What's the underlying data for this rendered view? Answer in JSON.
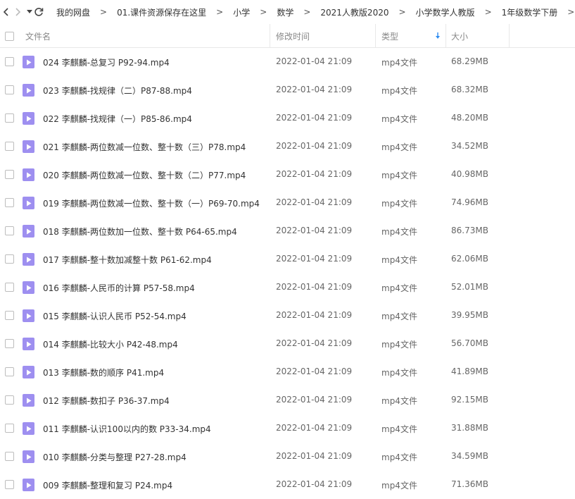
{
  "nav": {
    "back_icon": "chevron-left-icon",
    "forward_icon": "chevron-right-icon",
    "history_icon": "caret-down-icon",
    "refresh_icon": "refresh-icon"
  },
  "breadcrumb": [
    "我的网盘",
    "01.课件资源保存在这里",
    "小学",
    "数学",
    "2021人教版2020",
    "小学数学人教版",
    "1年级数学下册"
  ],
  "breadcrumb_separator": ">",
  "columns": {
    "name": "文件名",
    "modified": "修改时间",
    "type": "类型",
    "size": "大小"
  },
  "sort": {
    "column": "type",
    "direction": "descending",
    "icon": "sort-arrow-down-icon",
    "color": "#2f8cf0"
  },
  "file_icon_color": "#9e8ff0",
  "files": [
    {
      "name": "024 李麒麟-总复习 P92-94.mp4",
      "modified": "2022-01-04 21:09",
      "type": "mp4文件",
      "size": "68.29MB"
    },
    {
      "name": "023 李麒麟-找规律（二）P87-88.mp4",
      "modified": "2022-01-04 21:09",
      "type": "mp4文件",
      "size": "68.32MB"
    },
    {
      "name": "022 李麒麟-找规律（一）P85-86.mp4",
      "modified": "2022-01-04 21:09",
      "type": "mp4文件",
      "size": "48.20MB"
    },
    {
      "name": "021 李麒麟-两位数减一位数、整十数（三）P78.mp4",
      "modified": "2022-01-04 21:09",
      "type": "mp4文件",
      "size": "34.52MB"
    },
    {
      "name": "020 李麒麟-两位数减一位数、整十数（二）P77.mp4",
      "modified": "2022-01-04 21:09",
      "type": "mp4文件",
      "size": "40.98MB"
    },
    {
      "name": "019 李麒麟-两位数减一位数、整十数（一）P69-70.mp4",
      "modified": "2022-01-04 21:09",
      "type": "mp4文件",
      "size": "74.96MB"
    },
    {
      "name": "018 李麒麟-两位数加一位数、整十数 P64-65.mp4",
      "modified": "2022-01-04 21:09",
      "type": "mp4文件",
      "size": "86.73MB"
    },
    {
      "name": "017 李麒麟-整十数加减整十数 P61-62.mp4",
      "modified": "2022-01-04 21:09",
      "type": "mp4文件",
      "size": "62.06MB"
    },
    {
      "name": "016 李麒麟-人民币的计算 P57-58.mp4",
      "modified": "2022-01-04 21:09",
      "type": "mp4文件",
      "size": "52.01MB"
    },
    {
      "name": "015 李麒麟-认识人民币 P52-54.mp4",
      "modified": "2022-01-04 21:09",
      "type": "mp4文件",
      "size": "39.95MB"
    },
    {
      "name": "014 李麒麟-比较大小 P42-48.mp4",
      "modified": "2022-01-04 21:09",
      "type": "mp4文件",
      "size": "56.70MB"
    },
    {
      "name": "013 李麒麟-数的顺序 P41.mp4",
      "modified": "2022-01-04 21:09",
      "type": "mp4文件",
      "size": "41.89MB"
    },
    {
      "name": "012 李麒麟-数扣子 P36-37.mp4",
      "modified": "2022-01-04 21:09",
      "type": "mp4文件",
      "size": "92.15MB"
    },
    {
      "name": "011 李麒麟-认识100以内的数 P33-34.mp4",
      "modified": "2022-01-04 21:09",
      "type": "mp4文件",
      "size": "31.88MB"
    },
    {
      "name": "010 李麒麟-分类与整理 P27-28.mp4",
      "modified": "2022-01-04 21:09",
      "type": "mp4文件",
      "size": "34.59MB"
    },
    {
      "name": "009 李麒麟-整理和复习 P24.mp4",
      "modified": "2022-01-04 21:09",
      "type": "mp4文件",
      "size": "71.36MB"
    }
  ]
}
